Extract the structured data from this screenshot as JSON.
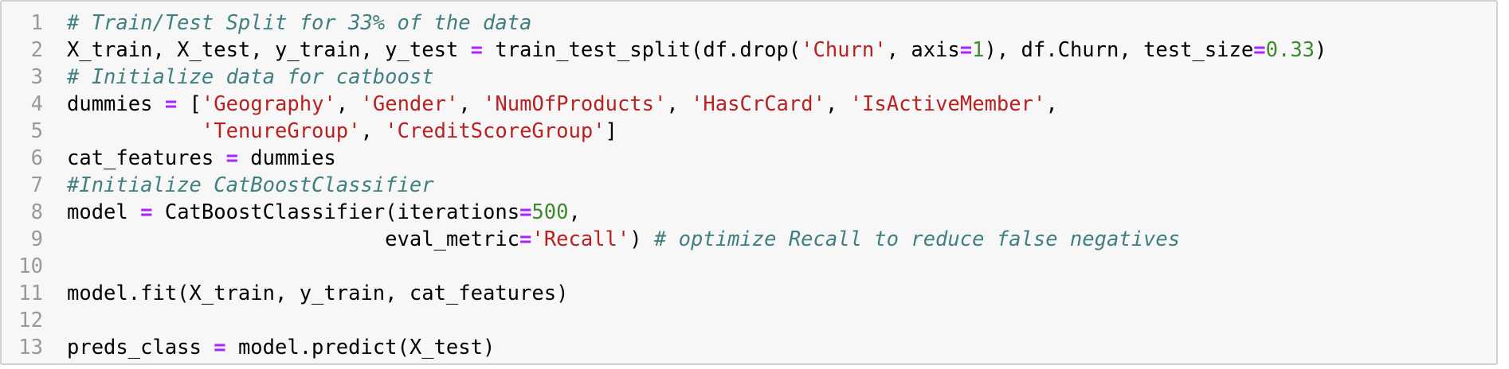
{
  "cell": {
    "line_numbers": [
      "1",
      "2",
      "3",
      "4",
      "5",
      "6",
      "7",
      "8",
      "9",
      "10",
      "11",
      "12",
      "13"
    ],
    "lines": [
      [
        {
          "t": "# Train/Test Split for 33% of the data",
          "c": "cm"
        }
      ],
      [
        {
          "t": "X_train, X_test, y_train, y_test ",
          "c": "kw"
        },
        {
          "t": "=",
          "c": "op"
        },
        {
          "t": " train_test_split(df.drop(",
          "c": "kw"
        },
        {
          "t": "'Churn'",
          "c": "str"
        },
        {
          "t": ", axis",
          "c": "kw"
        },
        {
          "t": "=",
          "c": "op"
        },
        {
          "t": "1",
          "c": "num"
        },
        {
          "t": "), df.Churn, test_size",
          "c": "kw"
        },
        {
          "t": "=",
          "c": "op"
        },
        {
          "t": "0.33",
          "c": "num"
        },
        {
          "t": ")",
          "c": "kw"
        }
      ],
      [
        {
          "t": "# Initialize data for catboost",
          "c": "cm"
        }
      ],
      [
        {
          "t": "dummies ",
          "c": "kw"
        },
        {
          "t": "=",
          "c": "op"
        },
        {
          "t": " [",
          "c": "kw"
        },
        {
          "t": "'Geography'",
          "c": "str"
        },
        {
          "t": ", ",
          "c": "kw"
        },
        {
          "t": "'Gender'",
          "c": "str"
        },
        {
          "t": ", ",
          "c": "kw"
        },
        {
          "t": "'NumOfProducts'",
          "c": "str"
        },
        {
          "t": ", ",
          "c": "kw"
        },
        {
          "t": "'HasCrCard'",
          "c": "str"
        },
        {
          "t": ", ",
          "c": "kw"
        },
        {
          "t": "'IsActiveMember'",
          "c": "str"
        },
        {
          "t": ",",
          "c": "kw"
        }
      ],
      [
        {
          "t": "           ",
          "c": "kw"
        },
        {
          "t": "'TenureGroup'",
          "c": "str"
        },
        {
          "t": ", ",
          "c": "kw"
        },
        {
          "t": "'CreditScoreGroup'",
          "c": "str"
        },
        {
          "t": "]",
          "c": "kw"
        }
      ],
      [
        {
          "t": "cat_features ",
          "c": "kw"
        },
        {
          "t": "=",
          "c": "op"
        },
        {
          "t": " dummies",
          "c": "kw"
        }
      ],
      [
        {
          "t": "#Initialize CatBoostClassifier",
          "c": "cm"
        }
      ],
      [
        {
          "t": "model ",
          "c": "kw"
        },
        {
          "t": "=",
          "c": "op"
        },
        {
          "t": " CatBoostClassifier(iterations",
          "c": "kw"
        },
        {
          "t": "=",
          "c": "op"
        },
        {
          "t": "500",
          "c": "num"
        },
        {
          "t": ",",
          "c": "kw"
        }
      ],
      [
        {
          "t": "                          eval_metric",
          "c": "kw"
        },
        {
          "t": "=",
          "c": "op"
        },
        {
          "t": "'Recall'",
          "c": "str"
        },
        {
          "t": ") ",
          "c": "kw"
        },
        {
          "t": "# optimize Recall to reduce false negatives",
          "c": "cm"
        }
      ],
      [],
      [
        {
          "t": "model.fit(X_train, y_train, cat_features)",
          "c": "kw"
        }
      ],
      [],
      [
        {
          "t": "preds_class ",
          "c": "kw"
        },
        {
          "t": "=",
          "c": "op"
        },
        {
          "t": " model.predict(X_test)",
          "c": "kw"
        }
      ]
    ]
  }
}
